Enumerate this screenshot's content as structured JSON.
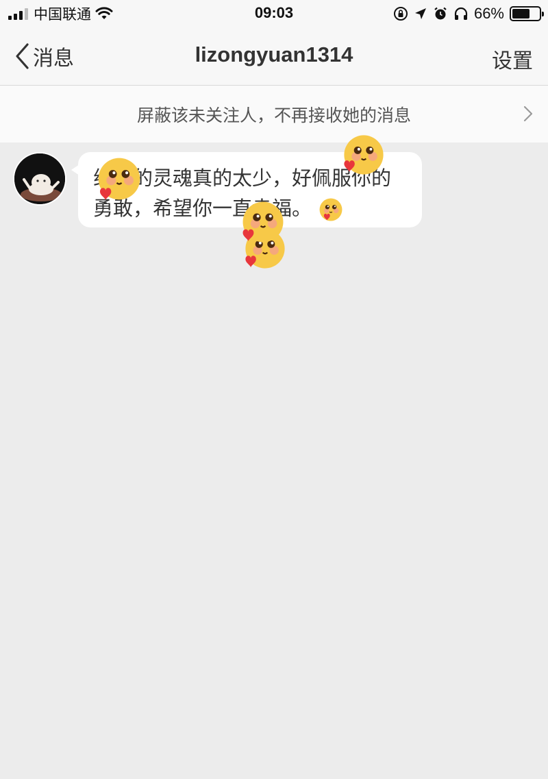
{
  "status_bar": {
    "carrier": "中国联通",
    "time": "09:03",
    "battery_percent_text": "66%",
    "battery_level": 0.66,
    "icons": [
      "signal-icon",
      "wifi-icon",
      "orientation-lock-icon",
      "location-icon",
      "alarm-icon",
      "headphones-icon",
      "battery-icon"
    ]
  },
  "nav": {
    "back_label": "消息",
    "title": "lizongyuan1314",
    "settings_label": "设置"
  },
  "banner": {
    "text": "屏蔽该未关注人，不再接收她的消息",
    "icon": "chevron-right-icon"
  },
  "message": {
    "line1": "纯粹的灵魂真的太少，好佩服你的",
    "line2": "勇敢，希望你一直幸福。",
    "emoji": "blush-heart-emoji"
  },
  "colors": {
    "background": "#ececec",
    "bar": "#f7f7f7",
    "bubble": "#ffffff",
    "emoji_face": "#f7c948",
    "heart": "#e8363c"
  }
}
